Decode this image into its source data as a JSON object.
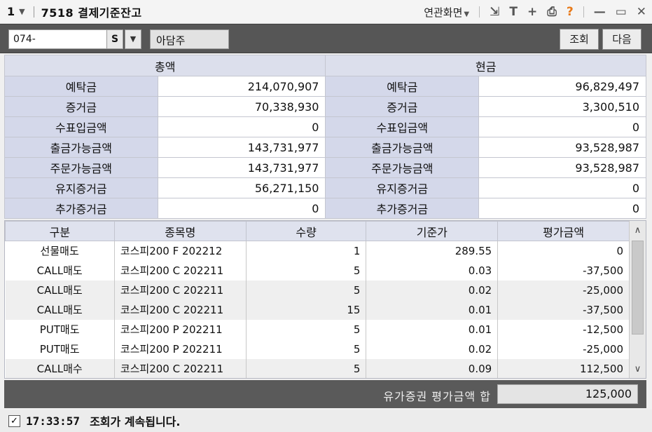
{
  "titlebar": {
    "window_num": "1",
    "screen_code": "7518",
    "title": "결제기준잔고",
    "related_screens": "연관화면"
  },
  "toolbar": {
    "account_value": "074-",
    "account_type": "S",
    "account_name": "아담주",
    "query_label": "조회",
    "next_label": "다음"
  },
  "summary": {
    "total_header": "총액",
    "cash_header": "현금",
    "rows": [
      {
        "label": "예탁금",
        "total": "214,070,907",
        "cash_label": "예탁금",
        "cash": "96,829,497"
      },
      {
        "label": "증거금",
        "total": "70,338,930",
        "cash_label": "증거금",
        "cash": "3,300,510"
      },
      {
        "label": "수표입금액",
        "total": "0",
        "cash_label": "수표입금액",
        "cash": "0"
      },
      {
        "label": "출금가능금액",
        "total": "143,731,977",
        "cash_label": "출금가능금액",
        "cash": "93,528,987"
      },
      {
        "label": "주문가능금액",
        "total": "143,731,977",
        "cash_label": "주문가능금액",
        "cash": "93,528,987"
      },
      {
        "label": "유지증거금",
        "total": "56,271,150",
        "cash_label": "유지증거금",
        "cash": "0"
      },
      {
        "label": "추가증거금",
        "total": "0",
        "cash_label": "추가증거금",
        "cash": "0"
      }
    ]
  },
  "grid": {
    "columns": [
      "구분",
      "종목명",
      "수량",
      "기준가",
      "평가금액"
    ],
    "rows": [
      [
        "선물매도",
        "코스피200 F 202212",
        "1",
        "289.55",
        "0"
      ],
      [
        "CALL매도",
        "코스피200 C 202211",
        "5",
        "0.03",
        "-37,500"
      ],
      [
        "CALL매도",
        "코스피200 C 202211",
        "5",
        "0.02",
        "-25,000"
      ],
      [
        "CALL매도",
        "코스피200 C 202211",
        "15",
        "0.01",
        "-37,500"
      ],
      [
        "PUT매도",
        "코스피200 P 202211",
        "5",
        "0.01",
        "-12,500"
      ],
      [
        "PUT매도",
        "코스피200 P 202211",
        "5",
        "0.02",
        "-25,000"
      ],
      [
        "CALL매수",
        "코스피200 C 202211",
        "5",
        "0.09",
        "112,500"
      ]
    ]
  },
  "total": {
    "label": "유가증권 평가금액 합",
    "value": "125,000"
  },
  "status": {
    "time": "17:33:57",
    "message": "조회가 계속됩니다."
  },
  "icons": [
    "link-icon",
    "text-icon",
    "plus-icon",
    "print-icon",
    "help-icon",
    "minimize-icon",
    "maximize-icon",
    "close-icon"
  ]
}
